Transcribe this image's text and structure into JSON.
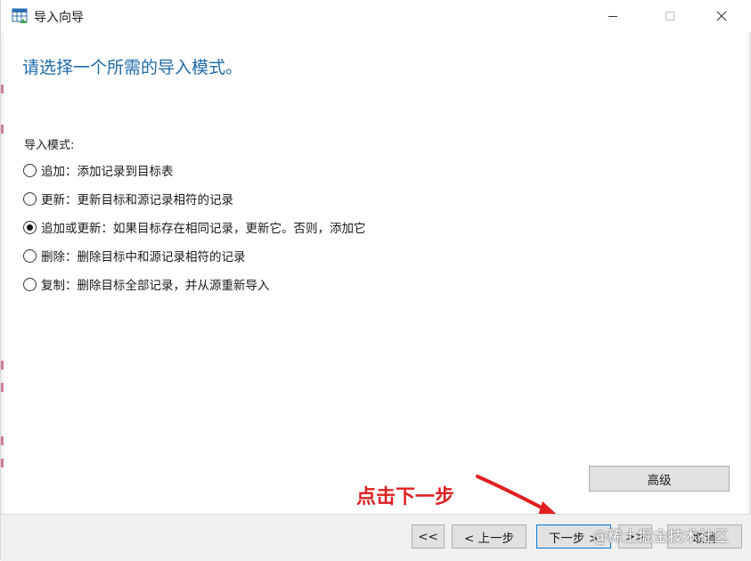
{
  "window": {
    "title": "导入向导",
    "minimize_icon": "minimize-icon",
    "maximize_icon": "maximize-icon",
    "close_icon": "close-icon"
  },
  "heading": "请选择一个所需的导入模式。",
  "import_mode": {
    "label": "导入模式:",
    "options": [
      {
        "label": "追加：添加记录到目标表",
        "checked": false
      },
      {
        "label": "更新：更新目标和源记录相符的记录",
        "checked": false
      },
      {
        "label": "追加或更新：如果目标存在相同记录，更新它。否则，添加它",
        "checked": true
      },
      {
        "label": "删除：删除目标中和源记录相符的记录",
        "checked": false
      },
      {
        "label": "复制：删除目标全部记录，并从源重新导入",
        "checked": false
      }
    ]
  },
  "buttons": {
    "advanced": "高级",
    "first": "<<",
    "prev": "< 上一步",
    "next": "下一步 >",
    "last": ">>",
    "cancel": "取消"
  },
  "annotation": {
    "text": "点击下一步",
    "color": "#e02020"
  },
  "watermark": "@稀土掘金技术社区",
  "colors": {
    "heading": "#1e6aa8",
    "button_face": "#e1e1e1",
    "default_button_border": "#0078d7"
  }
}
